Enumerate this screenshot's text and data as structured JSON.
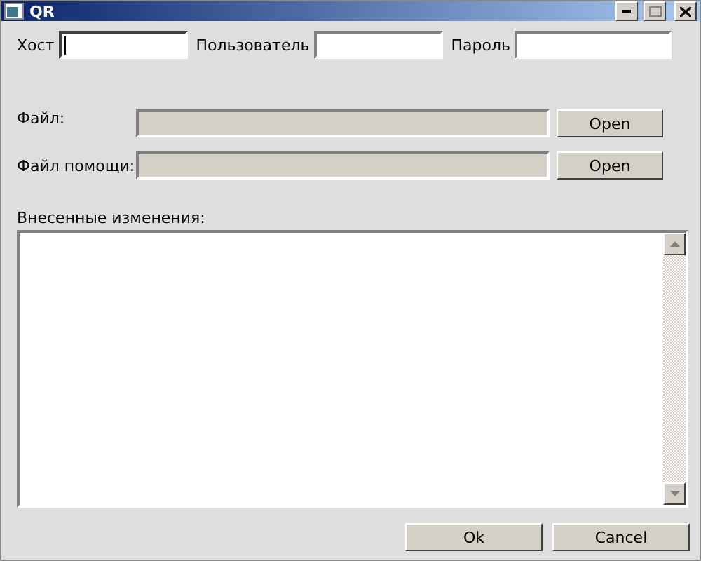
{
  "window": {
    "title": "QR"
  },
  "credentials": [
    {
      "label": "Хост",
      "focused": true
    },
    {
      "label": "Пользователь",
      "focused": false
    },
    {
      "label": "Пароль",
      "focused": false
    }
  ],
  "files": [
    {
      "label": "Файл:",
      "disabled": true,
      "button": "Open"
    },
    {
      "label": "Файл помощи:",
      "disabled": true,
      "button": "Open"
    }
  ],
  "changes": {
    "label": "Внесенные изменения:"
  },
  "buttons": [
    "Ok",
    "Cancel"
  ]
}
